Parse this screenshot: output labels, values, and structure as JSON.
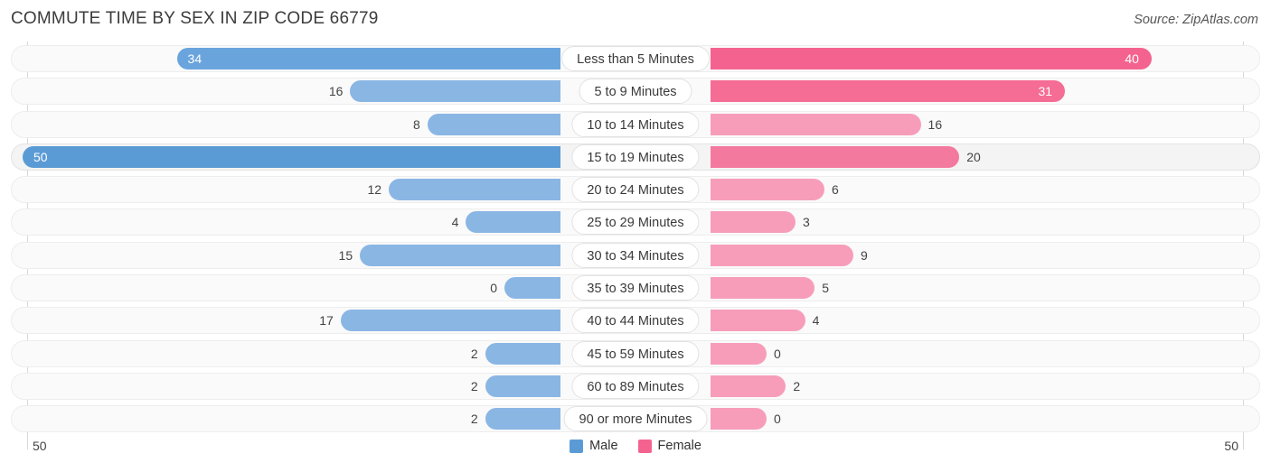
{
  "header": {
    "title": "COMMUTE TIME BY SEX IN ZIP CODE 66779",
    "source": "Source: ZipAtlas.com"
  },
  "legend": {
    "items": [
      {
        "label": "Male",
        "color": "#5b9bd5"
      },
      {
        "label": "Female",
        "color": "#f4638f"
      }
    ]
  },
  "axis": {
    "left_label": "50",
    "right_label": "50",
    "max": 50
  },
  "chart_data": {
    "type": "bar",
    "title": "COMMUTE TIME BY SEX IN ZIP CODE 66779",
    "subtitle": "Source: ZipAtlas.com",
    "orientation": "horizontal-diverging",
    "xlabel": "",
    "ylabel": "",
    "xlim": [
      50,
      50
    ],
    "grid": false,
    "legend_position": "bottom-center",
    "categories": [
      "Less than 5 Minutes",
      "5 to 9 Minutes",
      "10 to 14 Minutes",
      "15 to 19 Minutes",
      "20 to 24 Minutes",
      "25 to 29 Minutes",
      "30 to 34 Minutes",
      "35 to 39 Minutes",
      "40 to 44 Minutes",
      "45 to 59 Minutes",
      "60 to 89 Minutes",
      "90 or more Minutes"
    ],
    "series": [
      {
        "name": "Male",
        "values": [
          34,
          16,
          8,
          50,
          12,
          4,
          15,
          0,
          17,
          2,
          2,
          2
        ]
      },
      {
        "name": "Female",
        "values": [
          40,
          31,
          16,
          20,
          6,
          3,
          9,
          5,
          4,
          0,
          2,
          0
        ]
      }
    ],
    "highlighted_category": "15 to 19 Minutes"
  },
  "rows": [
    {
      "label": "Less than 5 Minutes",
      "male": "34",
      "female": "40"
    },
    {
      "label": "5 to 9 Minutes",
      "male": "16",
      "female": "31"
    },
    {
      "label": "10 to 14 Minutes",
      "male": "8",
      "female": "16"
    },
    {
      "label": "15 to 19 Minutes",
      "male": "50",
      "female": "20"
    },
    {
      "label": "20 to 24 Minutes",
      "male": "12",
      "female": "6"
    },
    {
      "label": "25 to 29 Minutes",
      "male": "4",
      "female": "3"
    },
    {
      "label": "30 to 34 Minutes",
      "male": "15",
      "female": "9"
    },
    {
      "label": "35 to 39 Minutes",
      "male": "0",
      "female": "5"
    },
    {
      "label": "40 to 44 Minutes",
      "male": "17",
      "female": "4"
    },
    {
      "label": "45 to 59 Minutes",
      "male": "2",
      "female": "0"
    },
    {
      "label": "60 to 89 Minutes",
      "male": "2",
      "female": "2"
    },
    {
      "label": "90 or more Minutes",
      "male": "2",
      "female": "0"
    }
  ]
}
